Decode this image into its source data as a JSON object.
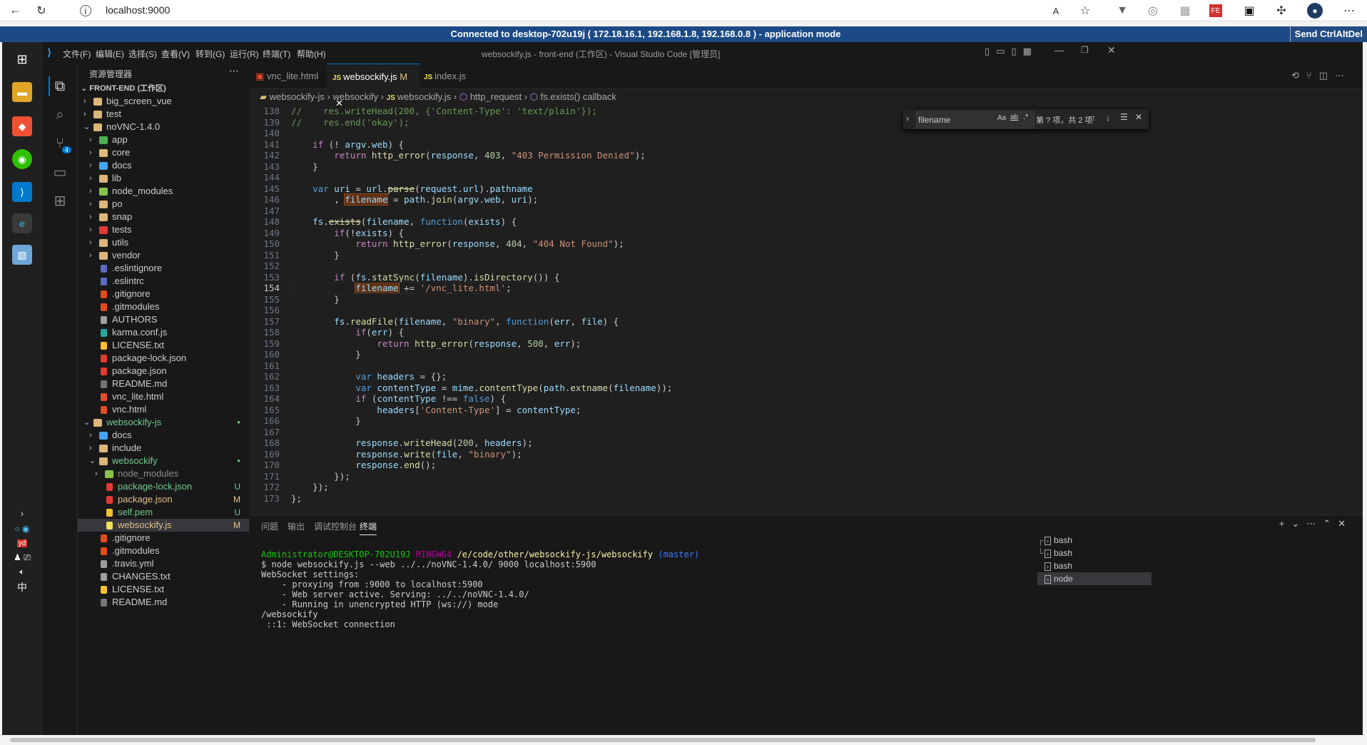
{
  "browser": {
    "url": "localhost:9000",
    "back_icon": "back-arrow-icon",
    "reload_icon": "reload-icon"
  },
  "vnc": {
    "banner": "Connected to desktop-702u19j ( 172.18.16.1, 192.168.1.8, 192.168.0.8 ) - application mode",
    "send_button": "Send CtrlAltDel"
  },
  "vscode": {
    "menu": [
      "文件(F)",
      "编辑(E)",
      "选择(S)",
      "查看(V)",
      "转到(G)",
      "运行(R)",
      "终端(T)",
      "帮助(H)"
    ],
    "title": "websockify.js - front-end (工作区) - Visual Studio Code [管理员]",
    "sidebar_header": "资源管理器",
    "workspace": "FRONT-END (工作区)",
    "git_badge": "4",
    "tree": [
      {
        "name": "big_screen_vue",
        "depth": 1,
        "twist": "›",
        "type": "folder",
        "color": "#dcb67a"
      },
      {
        "name": "test",
        "depth": 1,
        "twist": "›",
        "type": "folder",
        "color": "#dcb67a"
      },
      {
        "name": "noVNC-1.4.0",
        "depth": 1,
        "twist": "⌄",
        "type": "folder",
        "color": "#dcb67a"
      },
      {
        "name": "app",
        "depth": 2,
        "twist": "›",
        "type": "folder",
        "color": "#4caf50"
      },
      {
        "name": "core",
        "depth": 2,
        "twist": "›",
        "type": "folder",
        "color": "#dcb67a"
      },
      {
        "name": "docs",
        "depth": 2,
        "twist": "›",
        "type": "folder",
        "color": "#42a5f5"
      },
      {
        "name": "lib",
        "depth": 2,
        "twist": "›",
        "type": "folder",
        "color": "#dcb67a"
      },
      {
        "name": "node_modules",
        "depth": 2,
        "twist": "›",
        "type": "folder",
        "color": "#8bc34a"
      },
      {
        "name": "po",
        "depth": 2,
        "twist": "›",
        "type": "folder",
        "color": "#dcb67a"
      },
      {
        "name": "snap",
        "depth": 2,
        "twist": "›",
        "type": "folder",
        "color": "#dcb67a"
      },
      {
        "name": "tests",
        "depth": 2,
        "twist": "›",
        "type": "folder",
        "color": "#e53935"
      },
      {
        "name": "utils",
        "depth": 2,
        "twist": "›",
        "type": "folder",
        "color": "#dcb67a"
      },
      {
        "name": "vendor",
        "depth": 2,
        "twist": "›",
        "type": "folder",
        "color": "#dcb67a"
      },
      {
        "name": ".eslintignore",
        "depth": 2,
        "twist": "",
        "type": "file",
        "color": "#5c6bc0"
      },
      {
        "name": ".eslintrc",
        "depth": 2,
        "twist": "",
        "type": "file",
        "color": "#5c6bc0"
      },
      {
        "name": ".gitignore",
        "depth": 2,
        "twist": "",
        "type": "file",
        "color": "#e64a19"
      },
      {
        "name": ".gitmodules",
        "depth": 2,
        "twist": "",
        "type": "file",
        "color": "#e64a19"
      },
      {
        "name": "AUTHORS",
        "depth": 2,
        "twist": "",
        "type": "file",
        "color": "#9e9e9e"
      },
      {
        "name": "karma.conf.js",
        "depth": 2,
        "twist": "",
        "type": "file",
        "color": "#26a69a"
      },
      {
        "name": "LICENSE.txt",
        "depth": 2,
        "twist": "",
        "type": "file",
        "color": "#fbc02d"
      },
      {
        "name": "package-lock.json",
        "depth": 2,
        "twist": "",
        "type": "file",
        "color": "#e53935"
      },
      {
        "name": "package.json",
        "depth": 2,
        "twist": "",
        "type": "file",
        "color": "#e53935"
      },
      {
        "name": "README.md",
        "depth": 2,
        "twist": "",
        "type": "file",
        "color": "#757575"
      },
      {
        "name": "vnc_lite.html",
        "depth": 2,
        "twist": "",
        "type": "file",
        "color": "#e44d26"
      },
      {
        "name": "vnc.html",
        "depth": 2,
        "twist": "",
        "type": "file",
        "color": "#e44d26"
      },
      {
        "name": "websockify-js",
        "depth": 1,
        "twist": "⌄",
        "type": "folder",
        "color": "#dcb67a",
        "text_color": "#73c991",
        "dot": true
      },
      {
        "name": "docs",
        "depth": 2,
        "twist": "›",
        "type": "folder",
        "color": "#42a5f5"
      },
      {
        "name": "include",
        "depth": 2,
        "twist": "›",
        "type": "folder",
        "color": "#dcb67a"
      },
      {
        "name": "websockify",
        "depth": 2,
        "twist": "⌄",
        "type": "folder",
        "color": "#dcb67a",
        "text_color": "#73c991",
        "dot": true
      },
      {
        "name": "node_modules",
        "depth": 3,
        "twist": "›",
        "type": "folder",
        "color": "#8bc34a",
        "text_color": "#8c8c8c"
      },
      {
        "name": "package-lock.json",
        "depth": 3,
        "twist": "",
        "type": "file",
        "color": "#e53935",
        "text_color": "#73c991",
        "badge": "U"
      },
      {
        "name": "package.json",
        "depth": 3,
        "twist": "",
        "type": "file",
        "color": "#e53935",
        "text_color": "#e2c08d",
        "badge": "M"
      },
      {
        "name": "self.pem",
        "depth": 3,
        "twist": "",
        "type": "file",
        "color": "#fbc02d",
        "text_color": "#73c991",
        "badge": "U"
      },
      {
        "name": "websockify.js",
        "depth": 3,
        "twist": "",
        "type": "file",
        "color": "#f1e05a",
        "text_color": "#e2c08d",
        "badge": "M",
        "selected": true
      },
      {
        "name": ".gitignore",
        "depth": 2,
        "twist": "",
        "type": "file",
        "color": "#e64a19"
      },
      {
        "name": ".gitmodules",
        "depth": 2,
        "twist": "",
        "type": "file",
        "color": "#e64a19"
      },
      {
        "name": ".travis.yml",
        "depth": 2,
        "twist": "",
        "type": "file",
        "color": "#9e9e9e"
      },
      {
        "name": "CHANGES.txt",
        "depth": 2,
        "twist": "",
        "type": "file",
        "color": "#9e9e9e"
      },
      {
        "name": "LICENSE.txt",
        "depth": 2,
        "twist": "",
        "type": "file",
        "color": "#fbc02d"
      },
      {
        "name": "README.md",
        "depth": 2,
        "twist": "",
        "type": "file",
        "color": "#757575"
      }
    ],
    "tabs": [
      {
        "label": "vnc_lite.html",
        "icon": "html-file-icon",
        "active": false
      },
      {
        "label": "websockify.js",
        "modified": "M",
        "icon": "js-file-icon",
        "active": true
      },
      {
        "label": "index.js",
        "icon": "js-file-icon",
        "active": false
      }
    ],
    "breadcrumb": [
      "websockify-js",
      "websockify",
      "websockify.js",
      "http_request",
      "fs.exists() callback"
    ],
    "find": {
      "value": "filename",
      "status": "第 ? 项，共 2 项",
      "aa": "Aa",
      "ab": "ab",
      "regex": ".*"
    },
    "current_line": 154,
    "code": [
      {
        "n": 138,
        "html": "<span class=\"cm\">//    res.writeHead(200, {'Content-Type': 'text/plain'});</span>"
      },
      {
        "n": 139,
        "html": "<span class=\"cm\">//    res.end('okay');</span>"
      },
      {
        "n": 140,
        "html": ""
      },
      {
        "n": 141,
        "html": "    <span class=\"ctl\">if</span> (! <span class=\"var\">argv</span>.<span class=\"var\">web</span>) {"
      },
      {
        "n": 142,
        "html": "        <span class=\"ctl\">return</span> <span class=\"fn\">http_error</span>(<span class=\"var\">response</span>, <span class=\"num\">403</span>, <span class=\"str\">\"403 Permission Denied\"</span>);"
      },
      {
        "n": 143,
        "html": "    }"
      },
      {
        "n": 144,
        "html": ""
      },
      {
        "n": 145,
        "html": "    <span class=\"kw\">var</span> <span class=\"var\">uri</span> = <span class=\"var\">url</span>.<span class=\"fn\" style=\"text-decoration:line-through\">parse</span>(<span class=\"var\">request</span>.<span class=\"var\">url</span>).<span class=\"var\">pathname</span>"
      },
      {
        "n": 146,
        "html": "        , <span class=\"var hl\">filename</span> = <span class=\"var\">path</span>.<span class=\"fn\">join</span>(<span class=\"var\">argv</span>.<span class=\"var\">web</span>, <span class=\"var\">uri</span>);"
      },
      {
        "n": 147,
        "html": ""
      },
      {
        "n": 148,
        "html": "    <span class=\"var\">fs</span>.<span class=\"fn\" style=\"text-decoration:line-through\">exists</span>(<span class=\"var\">filename</span>, <span class=\"kw\">function</span>(<span class=\"var\">exists</span>) {"
      },
      {
        "n": 149,
        "html": "        <span class=\"ctl\">if</span>(!<span class=\"var\">exists</span>) {"
      },
      {
        "n": 150,
        "html": "            <span class=\"ctl\">return</span> <span class=\"fn\">http_error</span>(<span class=\"var\">response</span>, <span class=\"num\">404</span>, <span class=\"str\">\"404 Not Found\"</span>);"
      },
      {
        "n": 151,
        "html": "        }"
      },
      {
        "n": 152,
        "html": ""
      },
      {
        "n": 153,
        "html": "        <span class=\"ctl\">if</span> (<span class=\"var\">fs</span>.<span class=\"fn\">statSync</span>(<span class=\"var\">filename</span>).<span class=\"fn\">isDirectory</span>()) {"
      },
      {
        "n": 154,
        "html": "            <span class=\"var hl\">filename</span> += <span class=\"str\">'/vnc_lite.html'</span>;"
      },
      {
        "n": 155,
        "html": "        }"
      },
      {
        "n": 156,
        "html": ""
      },
      {
        "n": 157,
        "html": "        <span class=\"var\">fs</span>.<span class=\"fn\">readFile</span>(<span class=\"var\">filename</span>, <span class=\"str\">\"binary\"</span>, <span class=\"kw\">function</span>(<span class=\"var\">err</span>, <span class=\"var\">file</span>) {"
      },
      {
        "n": 158,
        "html": "            <span class=\"ctl\">if</span>(<span class=\"var\">err</span>) {"
      },
      {
        "n": 159,
        "html": "                <span class=\"ctl\">return</span> <span class=\"fn\">http_error</span>(<span class=\"var\">response</span>, <span class=\"num\">500</span>, <span class=\"var\">err</span>);"
      },
      {
        "n": 160,
        "html": "            }"
      },
      {
        "n": 161,
        "html": ""
      },
      {
        "n": 162,
        "html": "            <span class=\"kw\">var</span> <span class=\"var\">headers</span> = {};"
      },
      {
        "n": 163,
        "html": "            <span class=\"kw\">var</span> <span class=\"var\">contentType</span> = <span class=\"var\">mime</span>.<span class=\"fn\">contentType</span>(<span class=\"var\">path</span>.<span class=\"fn\">extname</span>(<span class=\"var\">filename</span>));"
      },
      {
        "n": 164,
        "html": "            <span class=\"ctl\">if</span> (<span class=\"var\">contentType</span> !== <span class=\"kw\">false</span>) {"
      },
      {
        "n": 165,
        "html": "                <span class=\"var\">headers</span>[<span class=\"str\">'Content-Type'</span>] = <span class=\"var\">contentType</span>;"
      },
      {
        "n": 166,
        "html": "            }"
      },
      {
        "n": 167,
        "html": ""
      },
      {
        "n": 168,
        "html": "            <span class=\"var\">response</span>.<span class=\"fn\">writeHead</span>(<span class=\"num\">200</span>, <span class=\"var\">headers</span>);"
      },
      {
        "n": 169,
        "html": "            <span class=\"var\">response</span>.<span class=\"fn\">write</span>(<span class=\"var\">file</span>, <span class=\"str\">\"binary\"</span>);"
      },
      {
        "n": 170,
        "html": "            <span class=\"var\">response</span>.<span class=\"fn\">end</span>();"
      },
      {
        "n": 171,
        "html": "        });"
      },
      {
        "n": 172,
        "html": "    });"
      },
      {
        "n": 173,
        "html": "};"
      }
    ],
    "panel_tabs": [
      "问题",
      "输出",
      "调试控制台",
      "终端"
    ],
    "terminal": [
      {
        "text": "Administrator@DESKTOP-702U19J MINGW64 /e/code/other/websockify-js/websockify (master)",
        "prompt": true
      },
      {
        "text": "$ node websockify.js --web ../../noVNC-1.4.0/ 9000 localhost:5900"
      },
      {
        "text": "WebSocket settings:"
      },
      {
        "text": "    - proxying from :9000 to localhost:5900"
      },
      {
        "text": "    - Web server active. Serving: ../../noVNC-1.4.0/"
      },
      {
        "text": "    - Running in unencrypted HTTP (ws://) mode"
      },
      {
        "text": "/websockify"
      },
      {
        "text": " ::1: WebSocket connection"
      }
    ],
    "prompt_parts": {
      "user": "Administrator@DESKTOP-702U19J",
      "env": "MINGW64",
      "path": "/e/code/other/websockify-js/websockify",
      "branch": "(master)"
    },
    "terminals": [
      {
        "label": "bash",
        "prefix": "┌"
      },
      {
        "label": "bash",
        "prefix": "└"
      },
      {
        "label": "bash",
        "prefix": ""
      },
      {
        "label": "node",
        "prefix": "",
        "active": true
      }
    ],
    "input_method": "中"
  }
}
